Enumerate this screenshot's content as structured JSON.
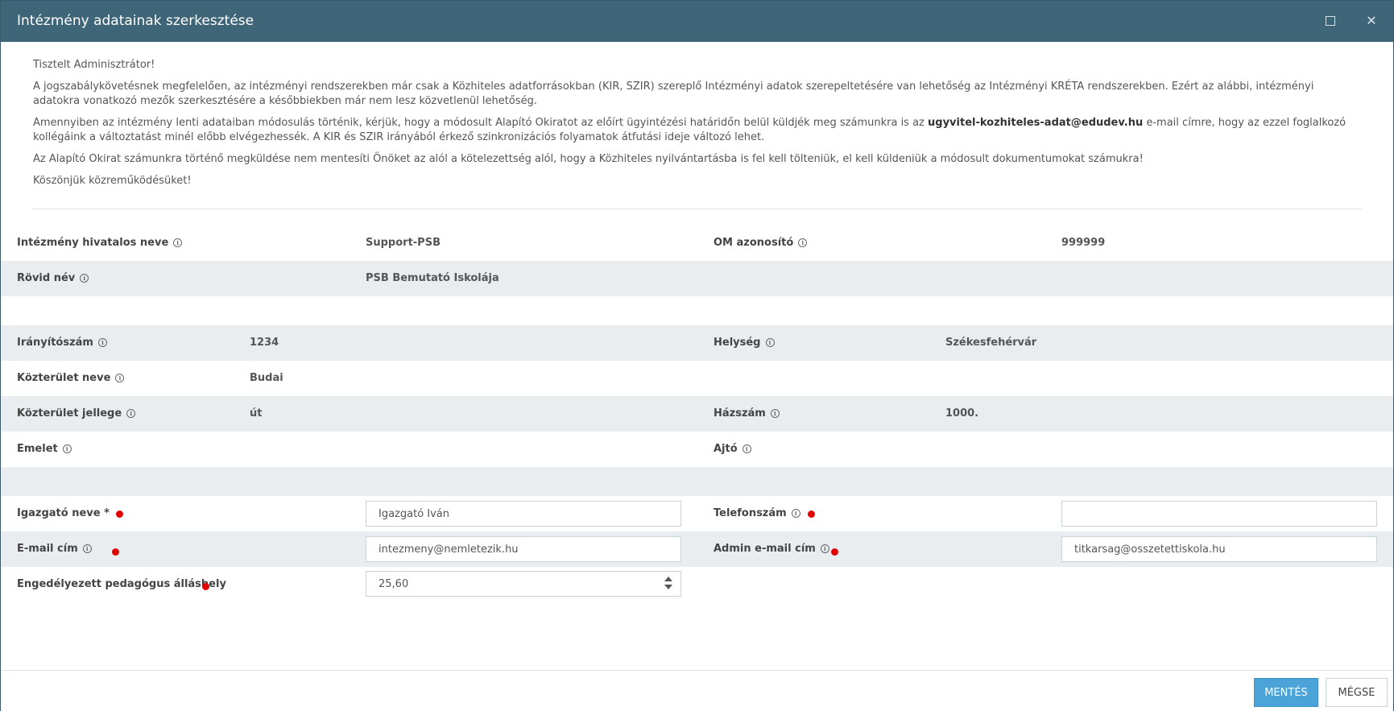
{
  "window": {
    "title": "Intézmény adatainak szerkesztése",
    "maximize_icon": "maximize-icon",
    "close_icon": "close-icon",
    "close_glyph": "✕"
  },
  "notice": {
    "greeting": "Tisztelt Adminisztrátor!",
    "p1": "A jogszabálykövetésnek megfelelően, az intézményi rendszerekben már csak a Közhiteles adatforrásokban (KIR, SZIR) szereplő Intézményi adatok szerepeltetésére van lehetőség az Intézményi KRÉTA rendszerekben. Ezért az alábbi, intézményi adatokra vonatkozó mezők szerkesztésére a későbbiekben már nem lesz közvetlenül lehetőség.",
    "p2_before": "Amennyiben az intézmény lenti adataiban módosulás történik, kérjük, hogy a módosult Alapító Okiratot az előírt ügyintézési határidőn belül küldjék meg számunkra is az ",
    "p2_email": "ugyvitel-kozhiteles-adat@edudev.hu",
    "p2_after": " e-mail címre, hogy az ezzel foglalkozó kollégáink a változtatást minél előbb elvégezhessék. A KIR és SZIR irányából érkező szinkronizációs folyamatok átfutási ideje változó lehet.",
    "p3": "Az Alapító Okirat számunkra történő megküldése nem mentesíti Önöket az alól a kötelezettség alól, hogy a Közhiteles nyilvántartásba is fel kell tölteniük, el kell küldeniük a módosult dokumentumokat számukra!",
    "p4": "Köszönjük közreműködésüket!"
  },
  "info_glyph": "i",
  "institution": {
    "official_name_label": "Intézmény hivatalos neve",
    "official_name_value": "Support-PSB",
    "om_label": "OM azonosító",
    "om_value": "999999",
    "short_name_label": "Rövid név",
    "short_name_value": "PSB Bemutató Iskolája"
  },
  "address": {
    "zip_label": "Irányítószám",
    "zip_value": "1234",
    "city_label": "Helység",
    "city_value": "Székesfehérvár",
    "street_label": "Közterület neve",
    "street_value": "Budai",
    "street_type_label": "Közterület jellege",
    "street_type_value": "út",
    "house_no_label": "Házszám",
    "house_no_value": "1000.",
    "floor_label": "Emelet",
    "floor_value": "",
    "door_label": "Ajtó",
    "door_value": ""
  },
  "contact": {
    "director_label": "Igazgató neve *",
    "director_value": "Igazgató Iván",
    "phone_label": "Telefonszám",
    "phone_value": "",
    "email_label": "E-mail cím",
    "email_value": "intezmeny@nemletezik.hu",
    "admin_email_label": "Admin e-mail cím",
    "admin_email_value": "titkarsag@osszetettiskola.hu",
    "teacher_positions_label": "Engedélyezett pedagógus álláshely",
    "teacher_positions_value": "25,60"
  },
  "required_marker_color": "#e00000",
  "footer": {
    "save_label": "MENTÉS",
    "cancel_label": "MÉGSE"
  },
  "colors": {
    "titlebar": "#3f6578",
    "primary_button": "#4ba3d7",
    "row_shade": "#e9edf0"
  }
}
